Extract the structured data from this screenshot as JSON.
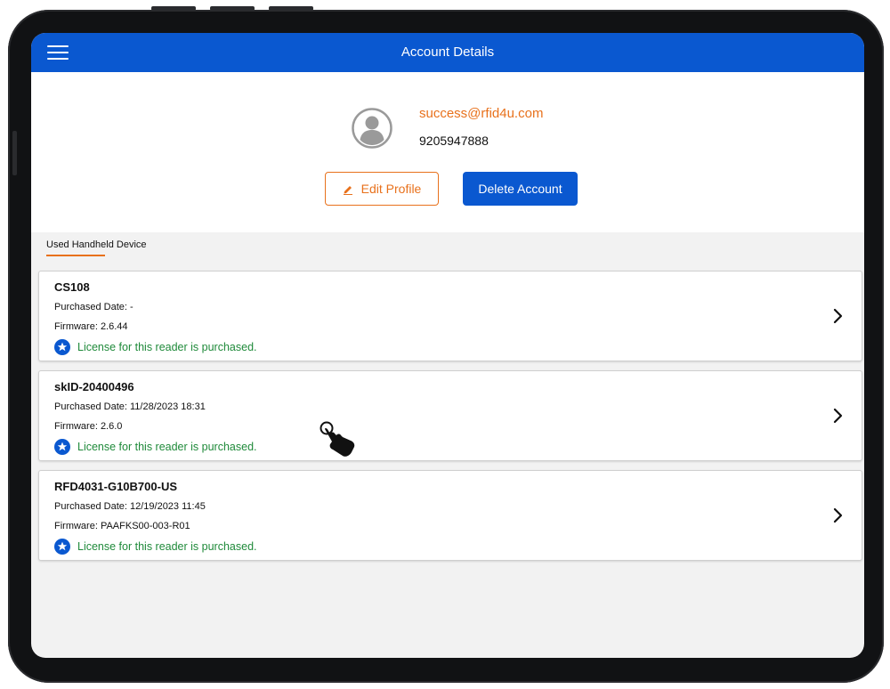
{
  "header": {
    "title": "Account Details",
    "menu_icon": "hamburger-menu-icon",
    "background_color": "#0a58d0"
  },
  "profile": {
    "avatar_icon": "user-avatar-icon",
    "email": "success@rfid4u.com",
    "phone": "9205947888",
    "edit_button_label": "Edit Profile",
    "edit_icon": "pencil-icon",
    "delete_button_label": "Delete Account"
  },
  "section": {
    "label": "Used Handheld Device"
  },
  "devices": [
    {
      "name": "CS108",
      "purchased": "Purchased Date: -",
      "firmware": "Firmware: 2.6.44",
      "license": "License for this reader is purchased."
    },
    {
      "name": "skID-20400496",
      "purchased": "Purchased Date: 11/28/2023 18:31",
      "firmware": "Firmware: 2.6.0",
      "license": "License for this reader is purchased."
    },
    {
      "name": "RFD4031-G10B700-US",
      "purchased": "Purchased Date: 12/19/2023 11:45",
      "firmware": "Firmware: PAAFKS00-003-R01",
      "license": "License for this reader is purchased."
    }
  ],
  "colors": {
    "accent_orange": "#e8711c",
    "primary_blue": "#0a58d0",
    "license_green": "#1f8a3a"
  },
  "cursor": {
    "icon": "hand-pointer-icon"
  }
}
